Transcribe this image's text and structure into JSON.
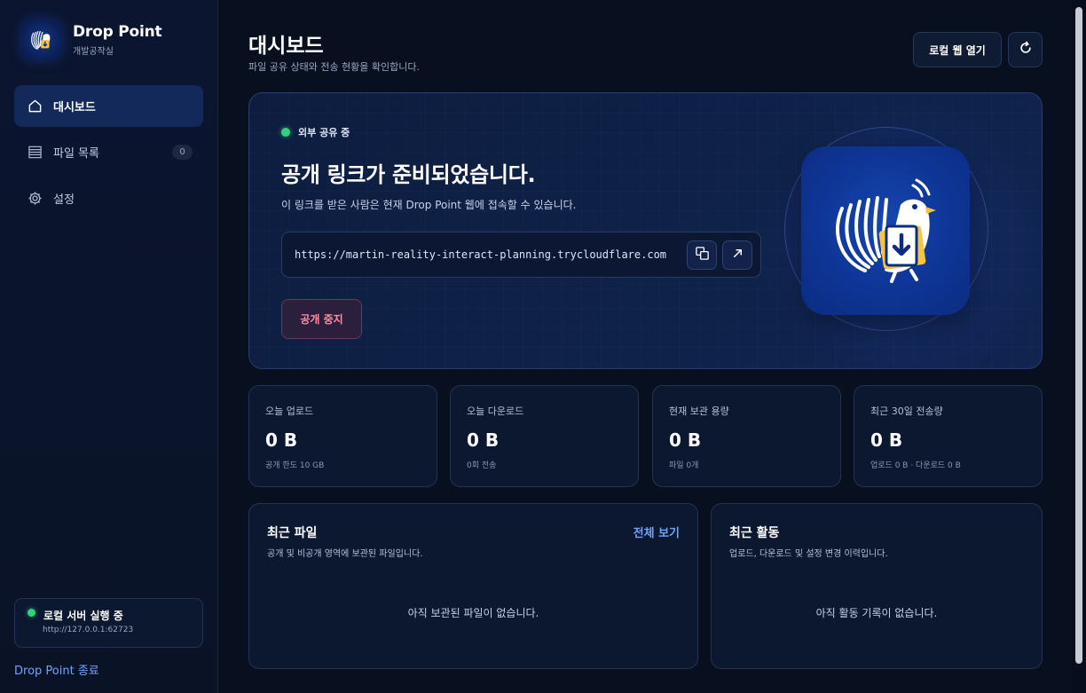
{
  "app": {
    "name": "Drop Point",
    "subtitle": "개발공작실"
  },
  "sidebar": {
    "items": [
      {
        "label": "대시보드",
        "icon": "home-icon",
        "active": true
      },
      {
        "label": "파일 목록",
        "icon": "list-icon",
        "badge": "0"
      },
      {
        "label": "설정",
        "icon": "gear-icon"
      }
    ],
    "server": {
      "status": "로컬 서버 실행 중",
      "url": "http://127.0.0.1:62723"
    },
    "quit_label": "Drop Point 종료"
  },
  "header": {
    "title": "대시보드",
    "subtitle": "파일 공유 상태와 전송 현황을 확인합니다.",
    "open_web_label": "로컬 웹 열기",
    "refresh_icon": "refresh-icon"
  },
  "hero": {
    "status": "외부 공유 중",
    "title": "공개 링크가 준비되었습니다.",
    "description": "이 링크를 받은 사람은 현재 Drop Point 웹에 접속할 수 있습니다.",
    "url": "https://martin-reality-interact-planning.trycloudflare.com",
    "copy_icon": "copy-icon",
    "open_icon": "external-link-icon",
    "stop_label": "공개 중지"
  },
  "stats": [
    {
      "label": "오늘 업로드",
      "value": "0 B",
      "sub": "공개 한도 10 GB"
    },
    {
      "label": "오늘 다운로드",
      "value": "0 B",
      "sub": "0회 전송"
    },
    {
      "label": "현재 보관 용량",
      "value": "0 B",
      "sub": "파일 0개"
    },
    {
      "label": "최근 30일 전송량",
      "value": "0 B",
      "sub": "업로드 0 B · 다운로드 0 B"
    }
  ],
  "recent_files": {
    "title": "최근 파일",
    "subtitle": "공개 및 비공개 영역에 보관된 파일입니다.",
    "link": "전체 보기",
    "empty": "아직 보관된 파일이 없습니다."
  },
  "recent_activity": {
    "title": "최근 활동",
    "subtitle": "업로드, 다운로드 및 설정 변경 이력입니다.",
    "empty": "아직 활동 기록이 없습니다."
  },
  "colors": {
    "accent": "#6ba4ff",
    "status_green": "#34d17c",
    "stop_text": "#ff8fa6",
    "background": "#08101f"
  }
}
